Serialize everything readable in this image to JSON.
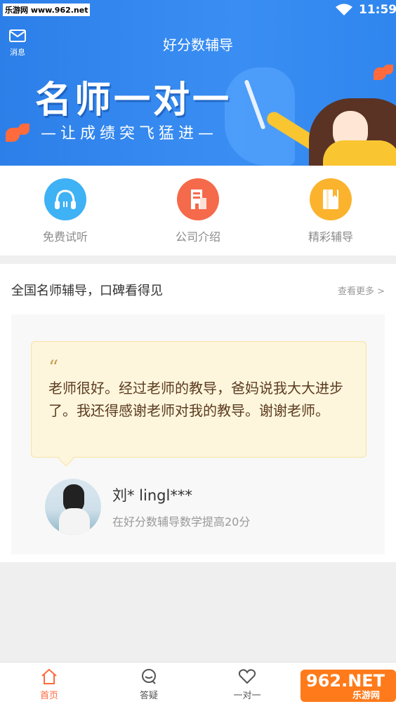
{
  "statusbar": {
    "watermark": "乐游网 www.962.net",
    "time": "11:59"
  },
  "header": {
    "message_label": "消息",
    "title": "好分数辅导"
  },
  "banner": {
    "headline": "名师一对一",
    "subline": "—让成绩突飞猛进—"
  },
  "quickmenu": [
    {
      "label": "免费试听",
      "icon": "headphones-icon",
      "color": "#3fb1f5"
    },
    {
      "label": "公司介绍",
      "icon": "building-icon",
      "color": "#f56a4b"
    },
    {
      "label": "精彩辅导",
      "icon": "book-icon",
      "color": "#fbb32e"
    }
  ],
  "section": {
    "title": "全国名师辅导，口碑看得见",
    "more": "查看更多 >",
    "testimonial": {
      "quote_mark": "“",
      "text": "老师很好。经过老师的教导，爸妈说我大大进步了。我还得感谢老师对我的教导。谢谢老师。",
      "name": "刘*  lingl***",
      "desc": "在好分数辅导数学提高20分"
    }
  },
  "tabbar": {
    "tabs": [
      {
        "label": "首页",
        "icon": "home-icon",
        "active": true
      },
      {
        "label": "答疑",
        "icon": "chat-icon",
        "active": false
      },
      {
        "label": "一对一",
        "icon": "heart-icon",
        "active": false
      }
    ],
    "accent": "#ff6a3c"
  },
  "watermark_logo": {
    "line1": "962.NET",
    "line2": "乐游网"
  }
}
